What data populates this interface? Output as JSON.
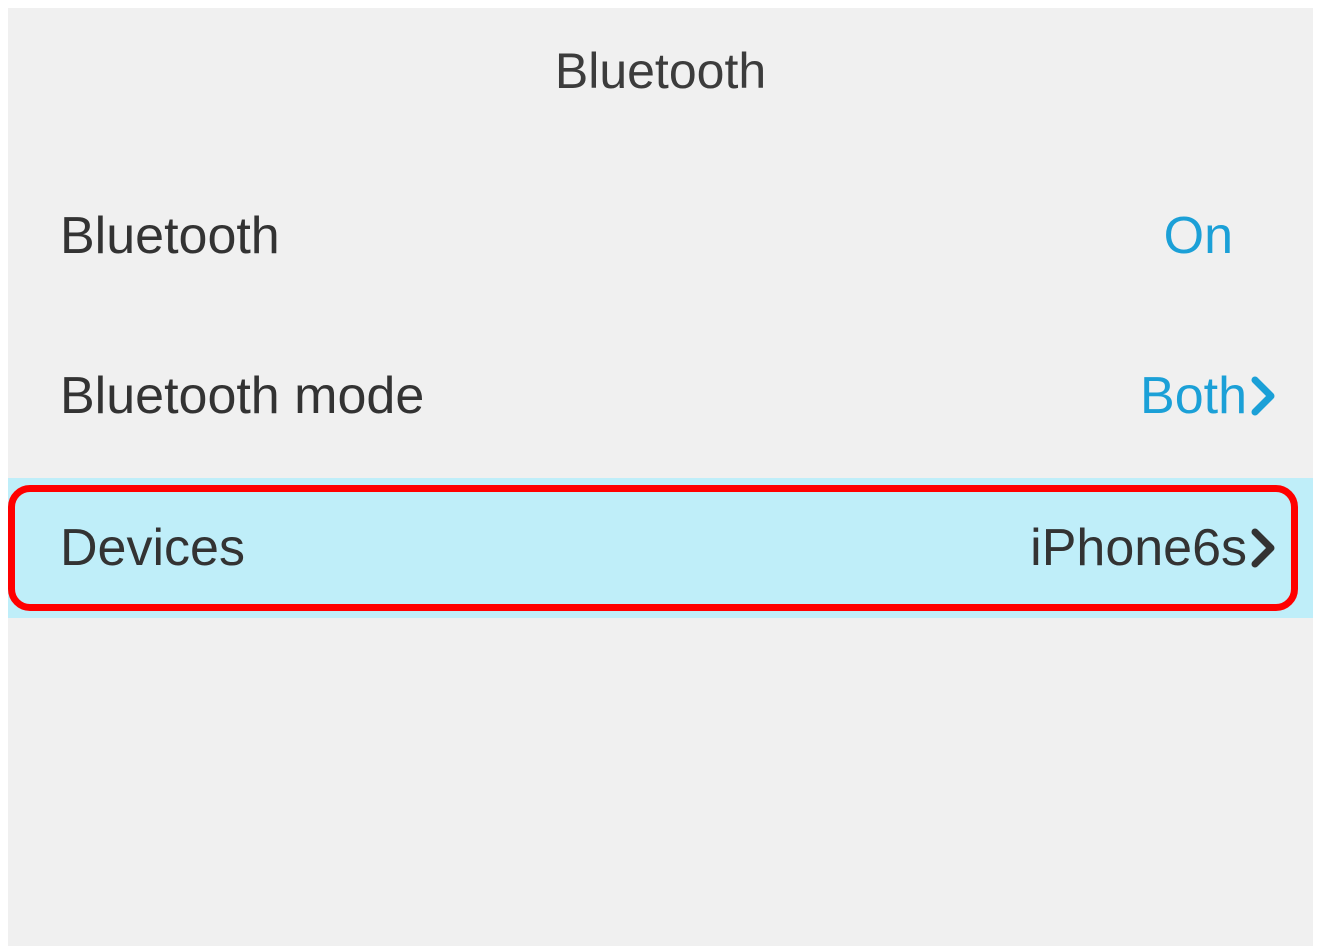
{
  "header": {
    "title": "Bluetooth"
  },
  "settings": [
    {
      "label": "Bluetooth",
      "value": "On"
    },
    {
      "label": "Bluetooth mode",
      "value": "Both"
    },
    {
      "label": "Devices",
      "value": "iPhone6s"
    }
  ],
  "colors": {
    "accent_value": "#1ba0d7",
    "selected_row": "#bfeef9",
    "highlight_box": "#ff0000",
    "background": "#f0f0f0"
  },
  "icons": {
    "chevron": "chevron-right-icon"
  }
}
